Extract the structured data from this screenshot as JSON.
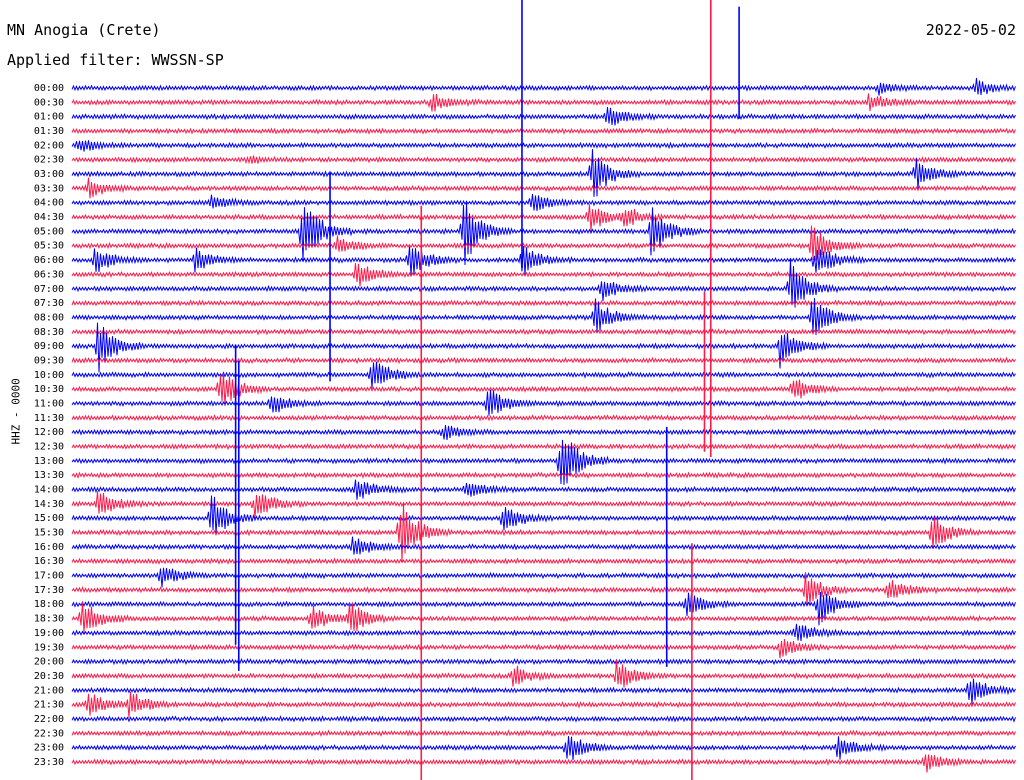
{
  "header": {
    "station": "MN Anogia (Crete)",
    "date": "2022-05-02",
    "filter": "Applied filter: WWSSN-SP",
    "channel": "HHZ - 0000"
  },
  "colors": {
    "trace_a": "#0000ff",
    "trace_b": "#ff1a4a"
  },
  "chart_data": {
    "type": "line",
    "title": "MN Anogia (Crete)",
    "ylabel": "HHZ - 0000",
    "row_labels": [
      "00:00",
      "00:30",
      "01:00",
      "01:30",
      "02:00",
      "02:30",
      "03:00",
      "03:30",
      "04:00",
      "04:30",
      "05:00",
      "05:30",
      "06:00",
      "06:30",
      "07:00",
      "07:30",
      "08:00",
      "08:30",
      "09:00",
      "09:30",
      "10:00",
      "10:30",
      "11:00",
      "11:30",
      "12:00",
      "12:30",
      "13:00",
      "13:30",
      "14:00",
      "14:30",
      "15:00",
      "15:30",
      "16:00",
      "16:30",
      "17:00",
      "17:30",
      "18:00",
      "18:30",
      "19:00",
      "19:30",
      "20:00",
      "20:30",
      "21:00",
      "21:30",
      "22:00",
      "22:30",
      "23:00",
      "23:30"
    ],
    "row_colors": [
      "trace_a",
      "trace_b"
    ],
    "minutes_per_row": 30,
    "events": [
      {
        "row": 0,
        "minute": 25.6,
        "amp": 6
      },
      {
        "row": 0,
        "minute": 28.7,
        "amp": 9
      },
      {
        "row": 1,
        "minute": 11.4,
        "amp": 10
      },
      {
        "row": 1,
        "minute": 25.3,
        "amp": 9
      },
      {
        "row": 2,
        "minute": 17.0,
        "amp": 12
      },
      {
        "row": 4,
        "minute": 0.2,
        "amp": 8
      },
      {
        "row": 5,
        "minute": 5.6,
        "amp": 4
      },
      {
        "row": 6,
        "minute": 16.5,
        "amp": 30
      },
      {
        "row": 6,
        "minute": 26.8,
        "amp": 18
      },
      {
        "row": 7,
        "minute": 0.5,
        "amp": 10
      },
      {
        "row": 8,
        "minute": 4.4,
        "amp": 7
      },
      {
        "row": 8,
        "minute": 14.6,
        "amp": 10
      },
      {
        "row": 9,
        "minute": 16.4,
        "amp": 16
      },
      {
        "row": 9,
        "minute": 17.5,
        "amp": 12
      },
      {
        "row": 10,
        "minute": 7.3,
        "amp": 42
      },
      {
        "row": 10,
        "minute": 12.4,
        "amp": 40
      },
      {
        "row": 10,
        "minute": 18.4,
        "amp": 28
      },
      {
        "row": 11,
        "minute": 8.4,
        "amp": 10
      },
      {
        "row": 11,
        "minute": 23.5,
        "amp": 22
      },
      {
        "row": 12,
        "minute": 0.7,
        "amp": 14
      },
      {
        "row": 12,
        "minute": 3.9,
        "amp": 12
      },
      {
        "row": 12,
        "minute": 10.7,
        "amp": 20
      },
      {
        "row": 12,
        "minute": 14.3,
        "amp": 18
      },
      {
        "row": 12,
        "minute": 23.6,
        "amp": 20
      },
      {
        "row": 13,
        "minute": 9.0,
        "amp": 15
      },
      {
        "row": 14,
        "minute": 16.8,
        "amp": 12
      },
      {
        "row": 14,
        "minute": 22.8,
        "amp": 30
      },
      {
        "row": 16,
        "minute": 16.6,
        "amp": 22
      },
      {
        "row": 16,
        "minute": 23.5,
        "amp": 24
      },
      {
        "row": 18,
        "minute": 0.8,
        "amp": 28
      },
      {
        "row": 18,
        "minute": 22.5,
        "amp": 22
      },
      {
        "row": 20,
        "minute": 9.5,
        "amp": 20
      },
      {
        "row": 21,
        "minute": 4.7,
        "amp": 24
      },
      {
        "row": 21,
        "minute": 22.9,
        "amp": 14
      },
      {
        "row": 22,
        "minute": 6.3,
        "amp": 12
      },
      {
        "row": 22,
        "minute": 13.2,
        "amp": 18
      },
      {
        "row": 24,
        "minute": 11.8,
        "amp": 8
      },
      {
        "row": 26,
        "minute": 15.5,
        "amp": 38
      },
      {
        "row": 28,
        "minute": 9.0,
        "amp": 14
      },
      {
        "row": 28,
        "minute": 12.5,
        "amp": 10
      },
      {
        "row": 29,
        "minute": 0.8,
        "amp": 18
      },
      {
        "row": 29,
        "minute": 5.8,
        "amp": 16
      },
      {
        "row": 30,
        "minute": 4.4,
        "amp": 26
      },
      {
        "row": 30,
        "minute": 13.7,
        "amp": 16
      },
      {
        "row": 31,
        "minute": 10.4,
        "amp": 36
      },
      {
        "row": 31,
        "minute": 27.3,
        "amp": 20
      },
      {
        "row": 32,
        "minute": 8.9,
        "amp": 12
      },
      {
        "row": 34,
        "minute": 2.8,
        "amp": 12
      },
      {
        "row": 35,
        "minute": 23.3,
        "amp": 18
      },
      {
        "row": 35,
        "minute": 25.9,
        "amp": 14
      },
      {
        "row": 36,
        "minute": 19.5,
        "amp": 14
      },
      {
        "row": 36,
        "minute": 23.7,
        "amp": 22
      },
      {
        "row": 37,
        "minute": 0.3,
        "amp": 20
      },
      {
        "row": 37,
        "minute": 7.6,
        "amp": 14
      },
      {
        "row": 37,
        "minute": 8.8,
        "amp": 18
      },
      {
        "row": 38,
        "minute": 23.0,
        "amp": 12
      },
      {
        "row": 39,
        "minute": 22.5,
        "amp": 10
      },
      {
        "row": 41,
        "minute": 14.0,
        "amp": 12
      },
      {
        "row": 41,
        "minute": 17.3,
        "amp": 16
      },
      {
        "row": 42,
        "minute": 28.5,
        "amp": 16
      },
      {
        "row": 43,
        "minute": 0.5,
        "amp": 14
      },
      {
        "row": 43,
        "minute": 1.8,
        "amp": 14
      },
      {
        "row": 46,
        "minute": 15.7,
        "amp": 18
      },
      {
        "row": 46,
        "minute": 24.3,
        "amp": 14
      },
      {
        "row": 47,
        "minute": 27.1,
        "amp": 10
      }
    ],
    "long_spikes": [
      {
        "row": 0,
        "minute": 14.3,
        "up": 88,
        "down": 180
      },
      {
        "row": 2,
        "minute": 21.2,
        "up": 110,
        "down": 2
      },
      {
        "row": 9,
        "minute": 20.3,
        "up": 260,
        "down": 240
      },
      {
        "row": 10,
        "minute": 8.2,
        "up": 60,
        "down": 150
      },
      {
        "row": 11,
        "minute": 11.1,
        "up": 40,
        "down": 620
      },
      {
        "row": 17,
        "minute": 20.1,
        "up": 40,
        "down": 120
      },
      {
        "row": 20,
        "minute": 5.2,
        "up": 30,
        "down": 270
      },
      {
        "row": 32,
        "minute": 18.9,
        "up": 120,
        "down": 120
      },
      {
        "row": 33,
        "minute": 19.7,
        "up": 18,
        "down": 220
      },
      {
        "row": 26,
        "minute": 5.3,
        "up": 100,
        "down": 210
      }
    ]
  }
}
